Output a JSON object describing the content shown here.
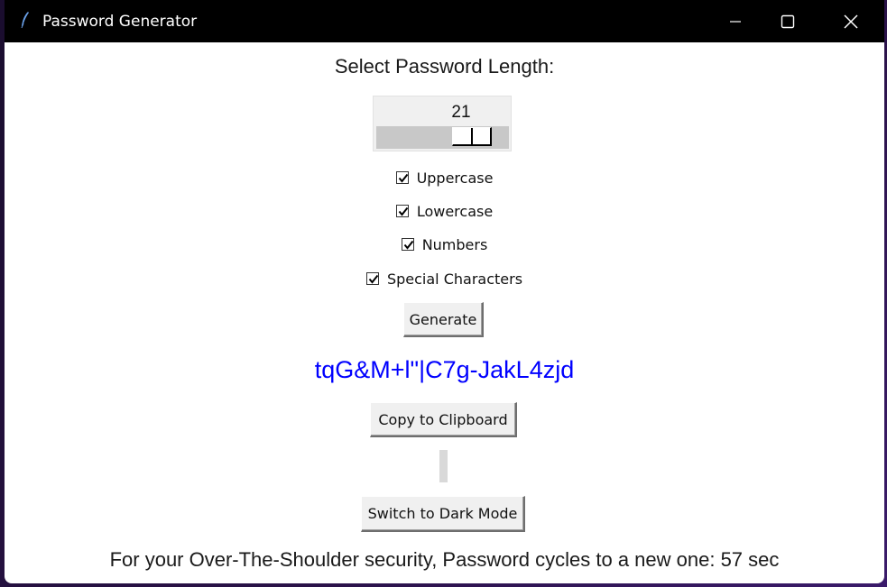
{
  "window": {
    "title": "Password Generator",
    "controls": {
      "minimize": "minimize-icon",
      "maximize": "maximize-icon",
      "close": "close-icon"
    }
  },
  "length": {
    "label": "Select Password Length:",
    "value": "21"
  },
  "options": [
    {
      "label": "Uppercase",
      "checked": true
    },
    {
      "label": "Lowercase",
      "checked": true
    },
    {
      "label": "Numbers",
      "checked": true
    },
    {
      "label": "Special Characters",
      "checked": true
    }
  ],
  "buttons": {
    "generate": "Generate",
    "copy": "Copy to Clipboard",
    "dark_mode": "Switch to Dark Mode"
  },
  "password": "tqG&M+l\"|C7g-JakL4zjd",
  "footer": "For your Over-The-Shoulder security, Password cycles to a new one: 57 sec",
  "colors": {
    "titlebar": "#000000",
    "password_text": "#0000ff",
    "window_bg": "#ffffff",
    "button_bg": "#f0f0f0"
  }
}
